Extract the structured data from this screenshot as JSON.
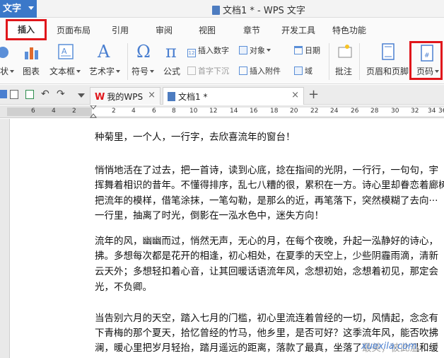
{
  "app": {
    "menu_label": "文字",
    "window_title": "文档1 * - WPS 文字"
  },
  "menu_tabs": [
    "插入",
    "页面布局",
    "引用",
    "审阅",
    "视图",
    "章节",
    "开发工具",
    "特色功能"
  ],
  "ribbon": {
    "shape_partial": "状",
    "chart": "图表",
    "textbox": "文本框",
    "wordart": "艺术字",
    "symbol": "符号",
    "formula": "公式",
    "insert_number": "插入数字",
    "object": "对象",
    "date": "日期",
    "drop_cap": "首字下沉",
    "insert_attachment": "插入附件",
    "field": "域",
    "comment": "批注",
    "header_footer": "页眉和页脚",
    "page_number": "页码"
  },
  "doc_tabs": {
    "wps_tab": "我的WPS",
    "doc_tab": "文档1 *"
  },
  "ruler": {
    "ticks": [
      "6",
      "4",
      "2",
      "2",
      "4",
      "6",
      "8",
      "10",
      "12",
      "14",
      "16",
      "18",
      "20",
      "22",
      "24",
      "26",
      "28",
      "30",
      "32",
      "34",
      "36"
    ]
  },
  "document": {
    "lines": [
      "种菊里，一个人，一行字，去欣喜流年的窗台！",
      "",
      "悄悄地活在了过去，把一首诗，读到心底，捻在指间的光阴，一行行，一句句，宇",
      "挥舞着相识的昔年。不懂得排序，乱七八糟的很，累积在一方。诗心里却眷恋着廊树",
      "把流年的模样，借笔涂抹，一笔勾勒，是那么的近，再笔落下，突然模糊了去向···",
      "一行里，抽离了时光，倒影在一泓水色中，迷失方向！",
      "",
      "流年的风，幽幽而过，悄然无声，无心的月，在每个夜晚，升起一泓静好的诗心，",
      "拂。多想每次都是花开的相逢，初心相处，在夏季的天空上，少些阴霾雨滴，清新",
      "云天外；多想轻扣着心音，让其回暖话语流年风，念想初始，念想着初见，那定会",
      "光，不负卿。",
      "",
      "当告别六月的天空，踏入七月的门槛，初心里流连着曾经的一切，风情起，念念有",
      "下青梅的那个夏天，拾忆曾经的竹马，他乡里，是否可好？这季流年风，能否吹拂",
      "澜，暖心里把岁月轻抬，踏月遥远的距离，落款了最真，坐落了最美，彼此温和缓"
    ]
  },
  "colors": {
    "accent": "#3b78c9",
    "highlight_box": "#e0161b"
  },
  "watermark": "xuexila.com"
}
